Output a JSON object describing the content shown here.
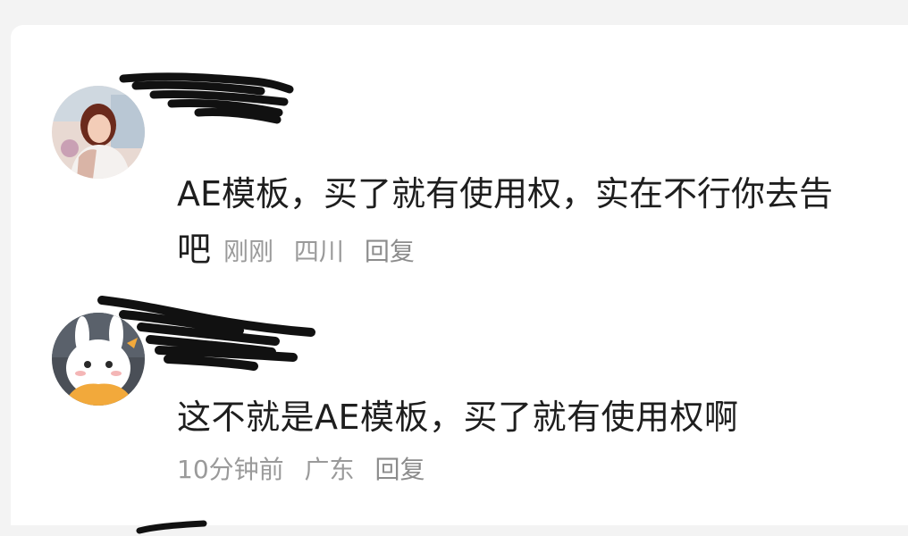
{
  "comments": [
    {
      "text_line1": "AE模板，买了就有使用权，实在不行你去告",
      "text_line2": "吧",
      "time": "刚刚",
      "location": "四川",
      "reply_label": "回复"
    },
    {
      "text": "这不就是AE模板，买了就有使用权啊",
      "time": "10分钟前",
      "location": "广东",
      "reply_label": "回复"
    }
  ],
  "colors": {
    "background": "#f3f3f3",
    "panel": "#ffffff",
    "text": "#1e1e1e",
    "meta": "#9a9a9a",
    "scribble": "#111111"
  },
  "icons": [
    "avatar-photo",
    "avatar-cartoon-rabbit"
  ]
}
